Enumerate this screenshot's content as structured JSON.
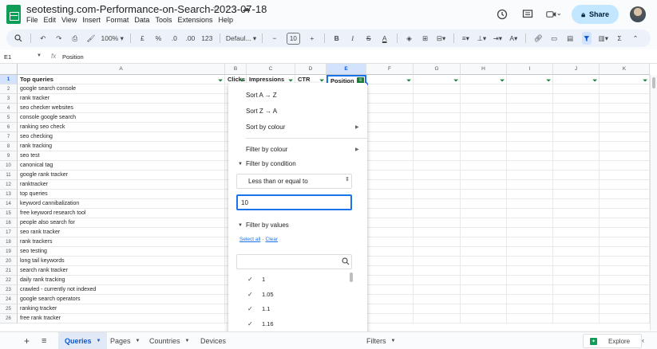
{
  "doc": {
    "title": "seotesting.com-Performance-on-Search-2023-07-18",
    "menus": [
      "File",
      "Edit",
      "View",
      "Insert",
      "Format",
      "Data",
      "Tools",
      "Extensions",
      "Help"
    ],
    "title_icons": [
      "star-icon",
      "move-to-folder-icon",
      "cloud-saved-icon"
    ]
  },
  "header": {
    "share_label": "Share",
    "icons": [
      "history-icon",
      "comments-icon",
      "meet-icon"
    ]
  },
  "toolbar": {
    "zoom": "100%",
    "currency": "£",
    "percent": "%",
    "dec_decrease": ".0",
    "dec_increase": ".00",
    "more_formats": "123",
    "font": "Defaul...",
    "font_size": "10",
    "minus": "−",
    "plus": "+",
    "bold": "B",
    "italic": "I",
    "strike": "S",
    "text_color": "A",
    "sum": "Σ"
  },
  "formula_bar": {
    "cell_ref": "E1",
    "fx": "fx",
    "value": "Position"
  },
  "grid": {
    "columns": [
      "A",
      "B",
      "C",
      "D",
      "E",
      "F",
      "G",
      "H",
      "I",
      "J",
      "K"
    ],
    "headers": {
      "A": "Top queries",
      "B": "Clicks",
      "C": "Impressions",
      "D": "CTR",
      "E": "Position"
    },
    "row_numbers": [
      "1",
      "2",
      "3",
      "4",
      "5",
      "6",
      "7",
      "8",
      "9",
      "10",
      "11",
      "12",
      "13",
      "14",
      "15",
      "16",
      "17",
      "18",
      "19",
      "20",
      "21",
      "22",
      "23",
      "24",
      "25",
      "26"
    ],
    "queries": [
      "google search console",
      "rank tracker",
      "seo checker websites",
      "console google search",
      "ranking seo check",
      "seo checking",
      "rank tracking",
      "seo test",
      "canonical tag",
      "google rank tracker",
      "ranktracker",
      "top queries",
      "keyword cannibalization",
      "free keyword research tool",
      "people also search for",
      "seo rank tracker",
      "rank trackers",
      "seo testing",
      "long tail keywords",
      "search rank tracker",
      "daily rank tracking",
      "crawled - currently not indexed",
      "google search operators",
      "ranking tracker",
      "free rank tracker"
    ]
  },
  "filter_menu": {
    "sort_az": "Sort A → Z",
    "sort_za": "Sort Z → A",
    "sort_by_colour": "Sort by colour",
    "filter_by_colour": "Filter by colour",
    "filter_by_condition": "Filter by condition",
    "condition": "Less than or equal to",
    "condition_value": "10",
    "filter_by_values": "Filter by values",
    "select_all": "Select all",
    "clear": "Clear",
    "search_placeholder": "",
    "values": [
      "1",
      "1.05",
      "1.1",
      "1.16"
    ]
  },
  "sheet_tabs": {
    "add": "+",
    "list": "≡",
    "tabs": [
      "Queries",
      "Pages",
      "Countries",
      "Devices",
      "Filters"
    ],
    "explore": "Explore"
  },
  "colors": {
    "accent": "#1a73e8",
    "filter_green": "#188038",
    "share_bg": "#c2e7ff",
    "selected_header": "#d3e3fd"
  }
}
